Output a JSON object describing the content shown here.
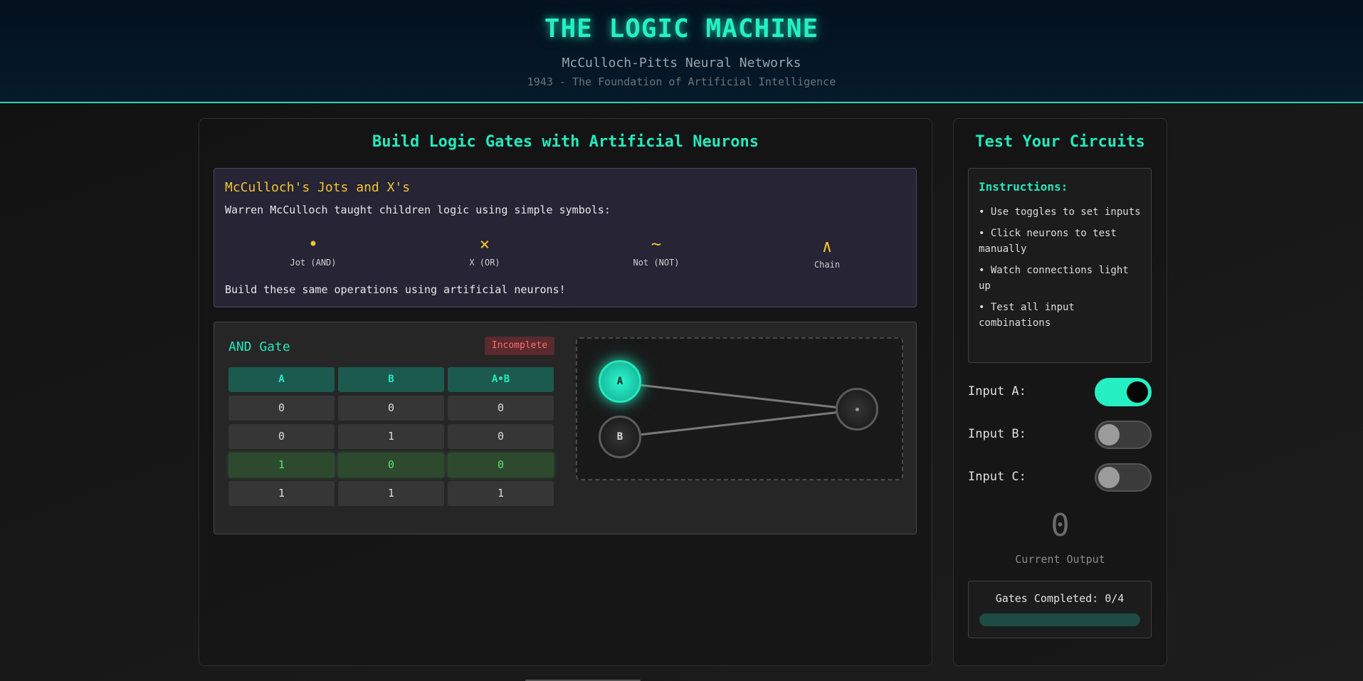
{
  "header": {
    "title": "THE LOGIC MACHINE",
    "subtitle": "McCulloch-Pitts Neural Networks",
    "tagline": "1943 - The Foundation of Artificial Intelligence"
  },
  "main": {
    "heading": "Build Logic Gates with Artificial Neurons",
    "info": {
      "title": "McCulloch's Jots and X's",
      "description": "Warren McCulloch taught children logic using simple symbols:",
      "symbols": [
        {
          "glyph": "•",
          "label": "Jot (AND)"
        },
        {
          "glyph": "×",
          "label": "X (OR)"
        },
        {
          "glyph": "~",
          "label": "Not (NOT)"
        },
        {
          "glyph": "∧",
          "label": "Chain"
        }
      ],
      "footer": "Build these same operations using artificial neurons!"
    },
    "gate": {
      "name": "AND Gate",
      "status": "Incomplete",
      "columns": [
        "A",
        "B",
        "A•B"
      ],
      "rows": [
        [
          "0",
          "0",
          "0"
        ],
        [
          "0",
          "1",
          "0"
        ],
        [
          "1",
          "0",
          "0"
        ],
        [
          "1",
          "1",
          "1"
        ]
      ],
      "highlighted_row": 2,
      "neurons": {
        "input_a": "A",
        "input_b": "B"
      }
    }
  },
  "side": {
    "heading": "Test Your Circuits",
    "instructions_title": "Instructions:",
    "instructions": [
      "• Use toggles to set inputs",
      "• Click neurons to test manually",
      "• Watch connections light up",
      "• Test all input combinations"
    ],
    "inputs": [
      {
        "label": "Input A:",
        "on": true
      },
      {
        "label": "Input B:",
        "on": false
      },
      {
        "label": "Input C:",
        "on": false
      }
    ],
    "output_value": "0",
    "output_label": "Current Output",
    "progress_text": "Gates Completed: 0/4",
    "progress_fraction": 0
  },
  "colors": {
    "accent": "#25e8bd",
    "warning": "#f5c431",
    "error": "#ff6b6b"
  }
}
